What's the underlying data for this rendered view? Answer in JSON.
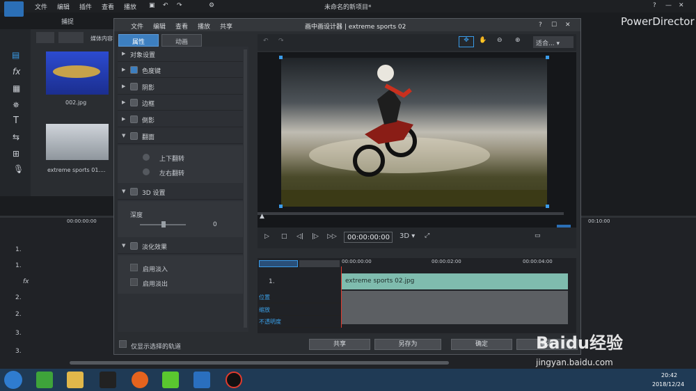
{
  "app": {
    "title": "未命名的新项目*",
    "brand": "PowerDirector",
    "menus": [
      "文件",
      "编辑",
      "插件",
      "查看",
      "播放"
    ],
    "capture": "捕捉",
    "media_tab": "媒体内容",
    "help": "?",
    "min": "—",
    "max": "☐",
    "close": "✕"
  },
  "media": [
    {
      "name": "002.jpg"
    },
    {
      "name": "extreme sports 01...."
    }
  ],
  "timeline": {
    "time_start": "00:00:00:00",
    "time_mid": "00:10:00",
    "tracks": [
      {
        "label": "1."
      },
      {
        "label": "1."
      },
      {
        "label": "fx"
      },
      {
        "label": "2."
      },
      {
        "label": "2."
      },
      {
        "label": "3."
      },
      {
        "label": "3."
      }
    ]
  },
  "dialog": {
    "title": "画中画设计器 | extreme sports 02",
    "menus": [
      "文件",
      "编辑",
      "查看",
      "播放",
      "共享"
    ],
    "tabs": {
      "props": "属性",
      "anim": "动画"
    },
    "sections": [
      "对象设置",
      "色度键",
      "阴影",
      "边框",
      "倒影",
      "翻面"
    ],
    "flip": {
      "vertical": "上下翻转",
      "horizontal": "左右翻转"
    },
    "three_d": {
      "label": "3D 设置",
      "depth": "深度",
      "depth_value": "0"
    },
    "fade": {
      "label": "淡化效果",
      "fade_in": "启用淡入",
      "fade_out": "启用淡出"
    },
    "only_selected": "仅显示选择的轨道",
    "fit": "适合...",
    "timecode": "00:00:00:00",
    "mode3d": "3D",
    "tl": {
      "t0": "00:00:00:00",
      "t1": "00:00:02:00",
      "t2": "00:00:04:00",
      "track": "1.",
      "clip": "extreme sports 02.jpg",
      "rows": [
        "位置",
        "缩放",
        "不透明度"
      ]
    },
    "buttons": {
      "share": "共享",
      "saveas": "另存为",
      "ok": "确定",
      "cancel": "取消"
    }
  },
  "taskbar": {
    "time": "20:42",
    "date": "2018/12/24"
  },
  "watermark": {
    "logo": "Baidu经验",
    "url": "jingyan.baidu.com"
  }
}
